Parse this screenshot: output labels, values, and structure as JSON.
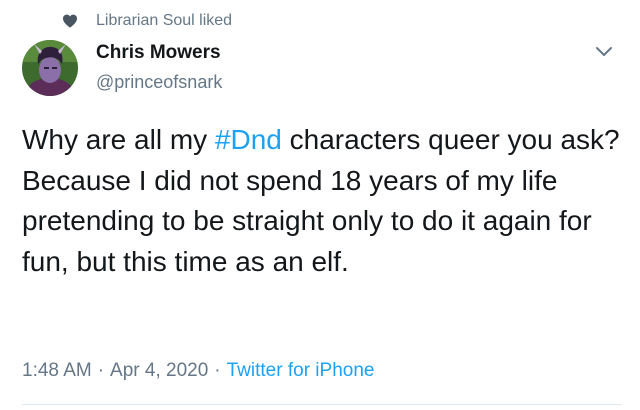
{
  "social_context": {
    "icon": "heart-icon",
    "text": "Librarian Soul liked"
  },
  "author": {
    "display_name": "Chris Mowers",
    "handle": "@princeofsnark",
    "avatar": "avatar"
  },
  "tweet": {
    "text_before": "Why are all my ",
    "hashtag": "#Dnd",
    "text_after": " characters queer you ask? Because I did not spend 18 years of my life pretending to be straight only to do it again for fun, but this time as an elf."
  },
  "meta": {
    "time": "1:48 AM",
    "separator": "·",
    "date": "Apr 4, 2020",
    "source": "Twitter for iPhone"
  },
  "colors": {
    "link": "#1da1f2",
    "muted": "#657786",
    "text": "#14171a"
  }
}
